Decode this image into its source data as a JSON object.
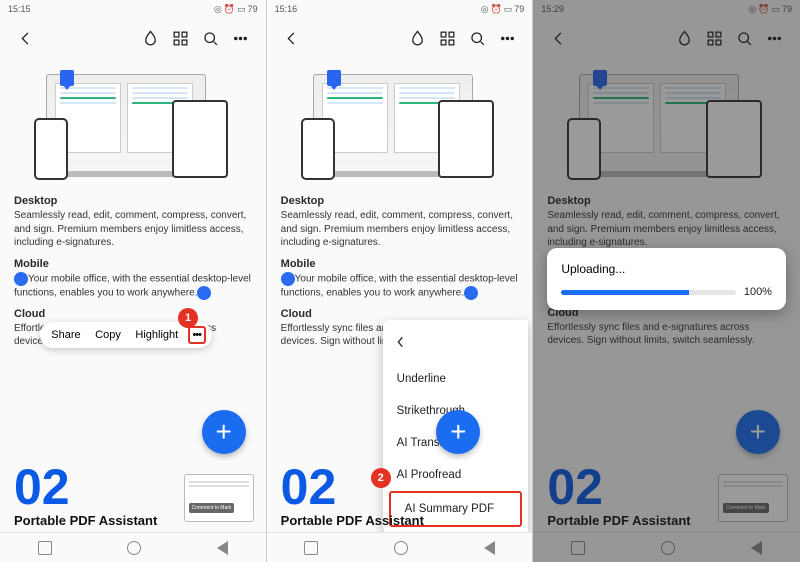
{
  "status": {
    "time1": "15:15",
    "time2": "15:16",
    "time3": "15:29",
    "battery": "79"
  },
  "sections": {
    "desktop": {
      "title": "Desktop",
      "body": "Seamlessly read, edit, comment, compress, convert, and sign. Premium members enjoy limitless access, including e-signatures."
    },
    "mobile": {
      "title": "Mobile",
      "body": "Your mobile office, with the essential desktop-level functions, enables you to work anywhere."
    },
    "cloud": {
      "title": "Cloud",
      "body_a": "Effortlessly sync files and e-signatures across devices. Sign without limits, switch seaml",
      "body_b": "Effortlessly sync files and e-signatures across devices. Sign without limits, switch seamlessly."
    }
  },
  "popup1": {
    "share": "Share",
    "copy": "Copy",
    "highlight": "Highlight"
  },
  "popup2": {
    "underline": "Underline",
    "strike": "Strikethrough",
    "translate": "AI Translate",
    "proofread": "AI Proofread",
    "summary": "AI Summary PDF"
  },
  "badges": {
    "one": "1",
    "two": "2"
  },
  "lower": {
    "num": "02",
    "title": "Portable PDF Assistant",
    "mini_btn": "Comment to Mark"
  },
  "upload": {
    "label": "Uploading...",
    "pct": "100%"
  }
}
